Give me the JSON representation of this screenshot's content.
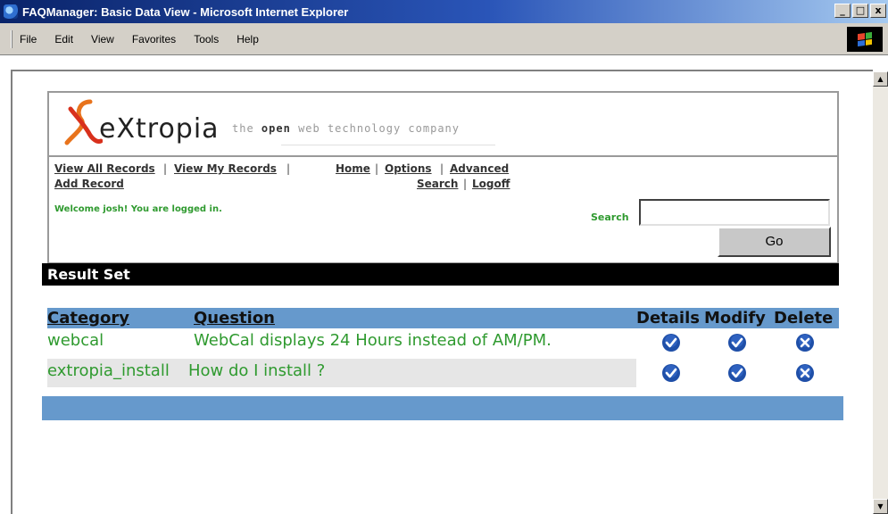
{
  "window": {
    "title": "FAQManager: Basic Data View - Microsoft Internet Explorer",
    "controls": [
      "_",
      "□",
      "x"
    ]
  },
  "menu": {
    "items": [
      "File",
      "Edit",
      "View",
      "Favorites",
      "Tools",
      "Help"
    ]
  },
  "header": {
    "logo_text": "eXtropia",
    "tagline_prefix": "the",
    "tagline_bold": "open",
    "tagline_rest": "web technology company"
  },
  "nav": {
    "view_all": "View All Records",
    "view_my": "View My Records",
    "add_record": "Add Record",
    "home": "Home",
    "options": "Options",
    "advanced": "Advanced",
    "search": "Search",
    "logoff": "Logoff",
    "separator": "|"
  },
  "welcome": "Welcome josh! You are logged in.",
  "search": {
    "label": "Search",
    "value": "",
    "button": "Go"
  },
  "result_set": "Result Set",
  "table": {
    "headers": {
      "category": "Category",
      "question": "Question",
      "details": "Details",
      "modify": "Modify",
      "delete": "Delete"
    },
    "rows": [
      {
        "category": "webcal",
        "question": "WebCal displays 24 Hours instead of AM/PM."
      },
      {
        "category": "extropia_install",
        "question": "How do I install ?"
      }
    ]
  },
  "colors": {
    "accent_green": "#2f9a2f",
    "table_blue": "#6699cc",
    "icon_blue": "#1f4fa8"
  },
  "icons": {
    "details": "check-circle-icon",
    "modify": "check-circle-icon",
    "delete": "x-circle-icon"
  }
}
